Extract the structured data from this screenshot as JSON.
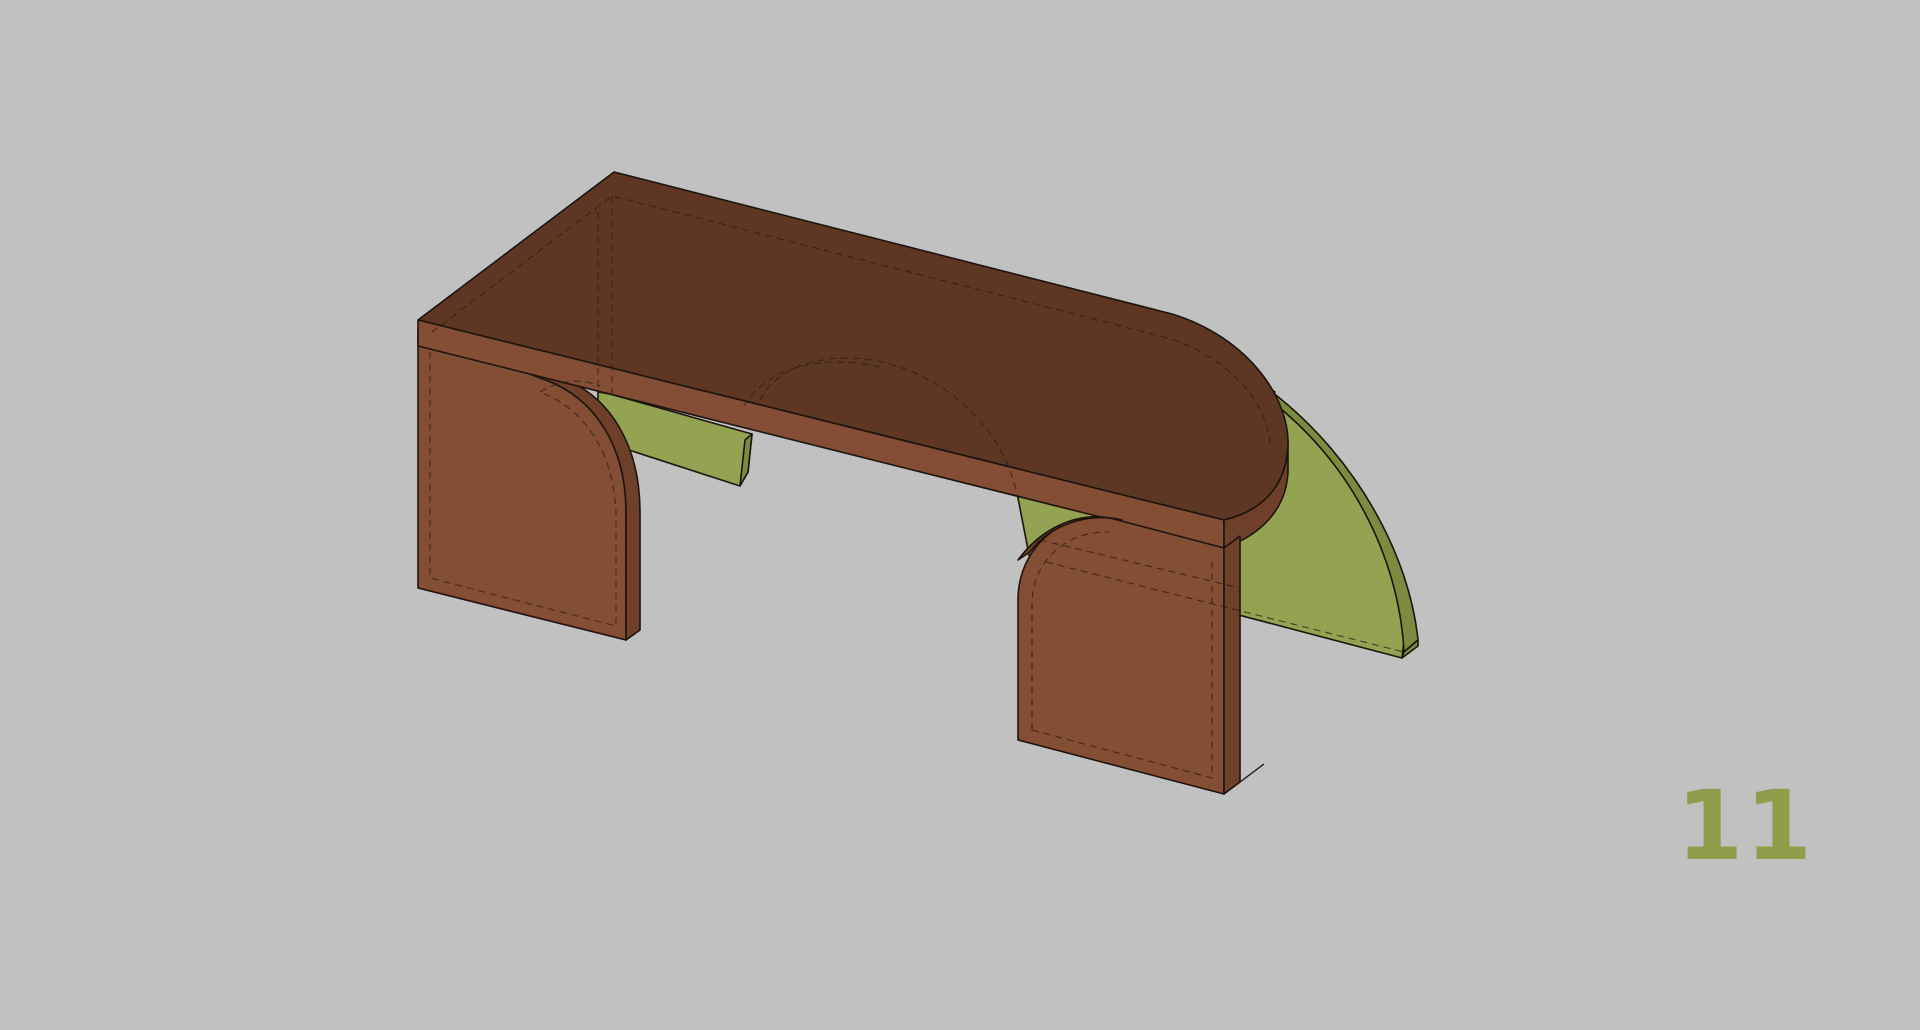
{
  "step_label": "11",
  "colors": {
    "background": "#c0c1c0",
    "wood_top": "#5e3624",
    "wood_side": "#834e34",
    "wood_edge": "#6e3f29",
    "panel_green": "#93a352",
    "panel_green_edge": "#7b8b3f",
    "label": "#8f9e4b"
  },
  "parts": [
    {
      "name": "tabletop",
      "material": "wood"
    },
    {
      "name": "left-leg",
      "material": "wood"
    },
    {
      "name": "right-leg",
      "material": "wood"
    },
    {
      "name": "back-panel",
      "material": "green"
    }
  ]
}
